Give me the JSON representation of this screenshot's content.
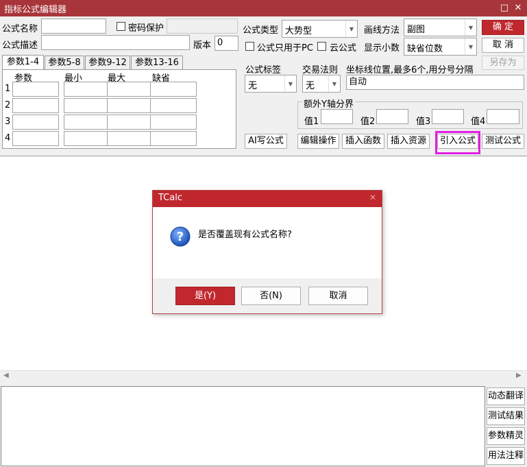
{
  "window": {
    "title": "指标公式编辑器",
    "buttons": [
      "□",
      "✕"
    ]
  },
  "form": {
    "name_label": "公式名称",
    "name_value": "",
    "password_label": "密码保护",
    "password_checked": false,
    "password_value": "",
    "desc_label": "公式描述",
    "desc_value": "",
    "version_label": "版本",
    "version_value": "0",
    "type_label": "公式类型",
    "type_value": "大势型",
    "pc_only_label": "公式只用于PC",
    "cloud_label": "云公式",
    "draw_label": "画线方法",
    "draw_value": "副图",
    "decimals_label": "显示小数",
    "decimals_value": "缺省位数",
    "tag_label": "公式标签",
    "tag_value": "无",
    "trade_label": "交易法则",
    "trade_value": "无",
    "coord_label": "坐标线位置,最多6个,用分号分隔",
    "coord_value": "自动",
    "yaxis_group_label": "额外Y轴分界",
    "yaxis_labels": [
      "值1",
      "值2",
      "值3",
      "值4"
    ],
    "yaxis_values": [
      "",
      "",
      "",
      ""
    ]
  },
  "actions": {
    "confirm": "确 定",
    "cancel": "取 消",
    "save_as": "另存为"
  },
  "tabs": [
    "参数1-4",
    "参数5-8",
    "参数9-12",
    "参数13-16"
  ],
  "params": {
    "headers": [
      "参数",
      "最小",
      "最大",
      "缺省"
    ],
    "rows": [
      {
        "num": "1",
        "name": "",
        "min": "",
        "max": "",
        "def": ""
      },
      {
        "num": "2",
        "name": "",
        "min": "",
        "max": "",
        "def": ""
      },
      {
        "num": "3",
        "name": "",
        "min": "",
        "max": "",
        "def": ""
      },
      {
        "num": "4",
        "name": "",
        "min": "",
        "max": "",
        "def": ""
      }
    ]
  },
  "toolbar": {
    "ai_write": "AI写公式",
    "edit_ops": "编辑操作",
    "insert_func": "插入函数",
    "insert_res": "插入资源",
    "import_formula": "引入公式",
    "test_formula": "测试公式"
  },
  "editor": {
    "content": ""
  },
  "side_buttons": [
    "动态翻译",
    "测试结果",
    "参数精灵",
    "用法注释"
  ],
  "dialog": {
    "title": "TCalc",
    "message": "是否覆盖现有公式名称?",
    "yes": "是(Y)",
    "no": "否(N)",
    "cancel": "取消"
  },
  "colors": {
    "titlebar": "#a8353a",
    "accent": "#c0282e",
    "highlight": "#e020e0"
  }
}
